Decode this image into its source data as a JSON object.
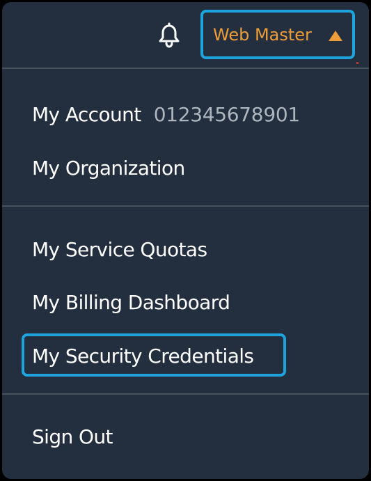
{
  "header": {
    "bell_icon": "bell-icon",
    "user_name": "Web Master",
    "caret_icon": "caret-up-icon",
    "accent_color": "#ec9c39",
    "highlight_color": "#1ea3dc"
  },
  "menu": {
    "account": {
      "label": "My Account",
      "number": "012345678901"
    },
    "organization": "My Organization",
    "service_quotas": "My Service Quotas",
    "billing_dashboard": "My Billing Dashboard",
    "security_credentials": "My Security Credentials",
    "sign_out": "Sign Out"
  },
  "colors": {
    "background": "#232f3e",
    "divider": "#48525d",
    "text": "#ffffff",
    "muted_text": "#adb5bd"
  }
}
